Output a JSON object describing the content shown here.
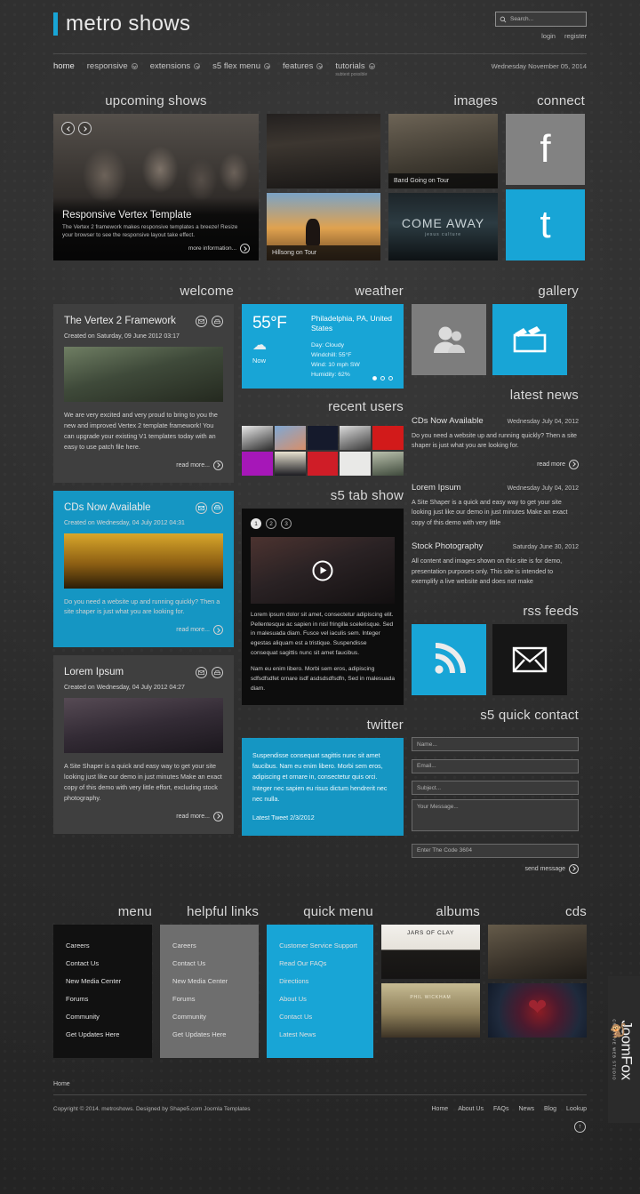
{
  "header": {
    "site_title": "metro shows",
    "search_placeholder": "Search...",
    "search_value": "",
    "login": "login",
    "register": "register",
    "date": "Wednesday November 05, 2014"
  },
  "nav": {
    "items": [
      {
        "label": "home",
        "has_chevron": false,
        "active": true,
        "sub": ""
      },
      {
        "label": "responsive",
        "has_chevron": true,
        "active": false,
        "sub": ""
      },
      {
        "label": "extensions",
        "has_chevron": true,
        "active": false,
        "sub": ""
      },
      {
        "label": "s5 flex menu",
        "has_chevron": true,
        "active": false,
        "sub": ""
      },
      {
        "label": "features",
        "has_chevron": true,
        "active": false,
        "sub": ""
      },
      {
        "label": "tutorials",
        "has_chevron": true,
        "active": false,
        "sub": "subtext possible"
      }
    ]
  },
  "top": {
    "shows_title": "upcoming shows",
    "images_title": "images",
    "connect_title": "connect",
    "slide": {
      "title": "Responsive Vertex Template",
      "text": "The Vertex 2 framework makes responsive templates a breeze! Resize your browser to see the responsive layout take effect.",
      "more_label": "more information..."
    },
    "tiles": [
      {
        "name": "hillsong-united-album",
        "label": ""
      },
      {
        "name": "hillsong-on-tour",
        "label": "Hillsong on Tour"
      },
      {
        "name": "band-going-on-tour",
        "label": "Band Going on Tour"
      },
      {
        "name": "come-away",
        "label": "",
        "big": "COME AWAY",
        "small": "jesus culture"
      }
    ],
    "social": [
      {
        "name": "facebook",
        "glyph": "f",
        "color": "#828282"
      },
      {
        "name": "twitter",
        "glyph": "t",
        "color": "#18a5d6"
      }
    ]
  },
  "mid": {
    "welcome_title": "welcome",
    "weather_title": "weather",
    "gallery_title": "gallery",
    "recent_users_title": "recent users",
    "latest_news_title": "latest news",
    "tabshow_title": "s5 tab show",
    "twitter_title": "twitter",
    "rss_title": "rss feeds",
    "contact_title": "s5 quick contact"
  },
  "articles": [
    {
      "title": "The Vertex 2 Framework",
      "created": "Created on Saturday, 09 June 2012 03:17",
      "body": "We are very excited and very proud to bring to you the new and improved Vertex 2 template framework! You can upgrade your existing V1 templates today with an easy to use patch file here.",
      "read_more": "read more...",
      "style": "dark"
    },
    {
      "title": "CDs Now Available",
      "created": "Created on Wednesday, 04 July 2012 04:31",
      "body": "Do you need a website up and running quickly? Then a site shaper is just what you are looking for.",
      "read_more": "read more...",
      "style": "blue"
    },
    {
      "title": "Lorem Ipsum",
      "created": "Created on Wednesday, 04 July 2012 04:27",
      "body": "A Site Shaper is a quick and easy way to get your site looking just like our demo in just minutes Make an exact copy of this demo with very little effort, excluding stock photography.",
      "read_more": "read more...",
      "style": "dark"
    }
  ],
  "weather": {
    "temp": "55°F",
    "condition_icon": "cloud-icon",
    "now": "Now",
    "location": "Philadelphia, PA, United States",
    "day": "Day: Cloudy",
    "windchill": "Windchill: 55°F",
    "wind": "Wind: 10 mph SW",
    "humidity": "Humidity: 62%",
    "slides": 3,
    "active_slide": 1
  },
  "tabshow": {
    "tabs": [
      "1",
      "2",
      "3"
    ],
    "active_tab": "1",
    "para1": "Lorem ipsum dolor sit amet, consectetur adipiscing elit. Pellentesque ac sapien in nisl fringilla scelerisque. Sed in malesuada diam. Fusce vel iaculis sem. Integer egestas aliquam est a tristique. Suspendisse consequat sagittis nunc sit amet faucibus.",
    "para2": "Nam eu enim libero. Morbi sem eros, adipiscing sdfsdfsdfet ornare isdf asdsdsdfsdfn, Sed in malesuada diam."
  },
  "twitter": {
    "text": "Suspendisse consequat sagittis nunc sit amet faucibus. Nam eu enim libero. Morbi sem eros, adipiscing et ornare in, consectetur quis orci. Integer nec sapien eu risus dictum hendrerit nec nec nulla.",
    "date": "Latest Tweet 2/3/2012"
  },
  "news": [
    {
      "title": "CDs Now Available",
      "date": "Wednesday July 04, 2012",
      "text": "Do you need a website up and running quickly? Then a site shaper is just what you are looking for.",
      "read_more": "read more"
    },
    {
      "title": "Lorem Ipsum",
      "date": "Wednesday July 04, 2012",
      "text": "A Site Shaper is a quick and easy way to get your site looking just like our demo in just minutes Make an exact copy of this demo with very little",
      "read_more": ""
    },
    {
      "title": "Stock Photography",
      "date": "Saturday June 30, 2012",
      "text": "All content and images shown on this site is for demo, presentation purposes only. This site is intended to exemplify a live website and does not make",
      "read_more": ""
    }
  ],
  "rss_tiles": [
    {
      "name": "rss-icon",
      "color": "#18a5d6"
    },
    {
      "name": "envelope-icon",
      "color": "#161616"
    }
  ],
  "gallery_tiles": [
    {
      "name": "people-icon",
      "color": "#7d7d7d"
    },
    {
      "name": "clapboard-icon",
      "color": "#18a5d6"
    }
  ],
  "contact": {
    "name_placeholder": "Name...",
    "email_placeholder": "Email...",
    "subject_placeholder": "Subject...",
    "message_placeholder": "Your Message...",
    "captcha_placeholder": "Enter The Code 3604",
    "send_label": "send message"
  },
  "footer_modules": {
    "menu_title": "menu",
    "helpful_title": "helpful links",
    "quick_title": "quick menu",
    "albums_title": "albums",
    "cds_title": "cds",
    "menu_items": [
      "Careers",
      "Contact Us",
      "New Media Center",
      "Forums",
      "Community",
      "Get Updates Here"
    ],
    "helpful_items": [
      "Careers",
      "Contact Us",
      "New Media Center",
      "Forums",
      "Community",
      "Get Updates Here"
    ],
    "quick_items": [
      "Customer Service Support",
      "Read Our FAQs",
      "Directions",
      "About Us",
      "Contact Us",
      "Latest News"
    ],
    "albums": [
      {
        "name": "jars-of-clay",
        "title": "JARS OF CLAY"
      },
      {
        "name": "phil-wickham",
        "title": "PHIL WICKHAM"
      }
    ],
    "cds": [
      {
        "name": "band-photo-cd",
        "title": ""
      },
      {
        "name": "i-heart-revolution",
        "title": ""
      }
    ]
  },
  "bottom": {
    "home_label": "Home",
    "copyright": "Copyright © 2014. metroshows. Designed by Shape5.com Joomla Templates",
    "links": [
      "Home",
      "About Us",
      "FAQs",
      "News",
      "Blog",
      "Lookup"
    ],
    "to_top": "↑"
  },
  "watermark": {
    "main": "JoomFox",
    "sub": "CREATIVE WEB STUDIO"
  }
}
